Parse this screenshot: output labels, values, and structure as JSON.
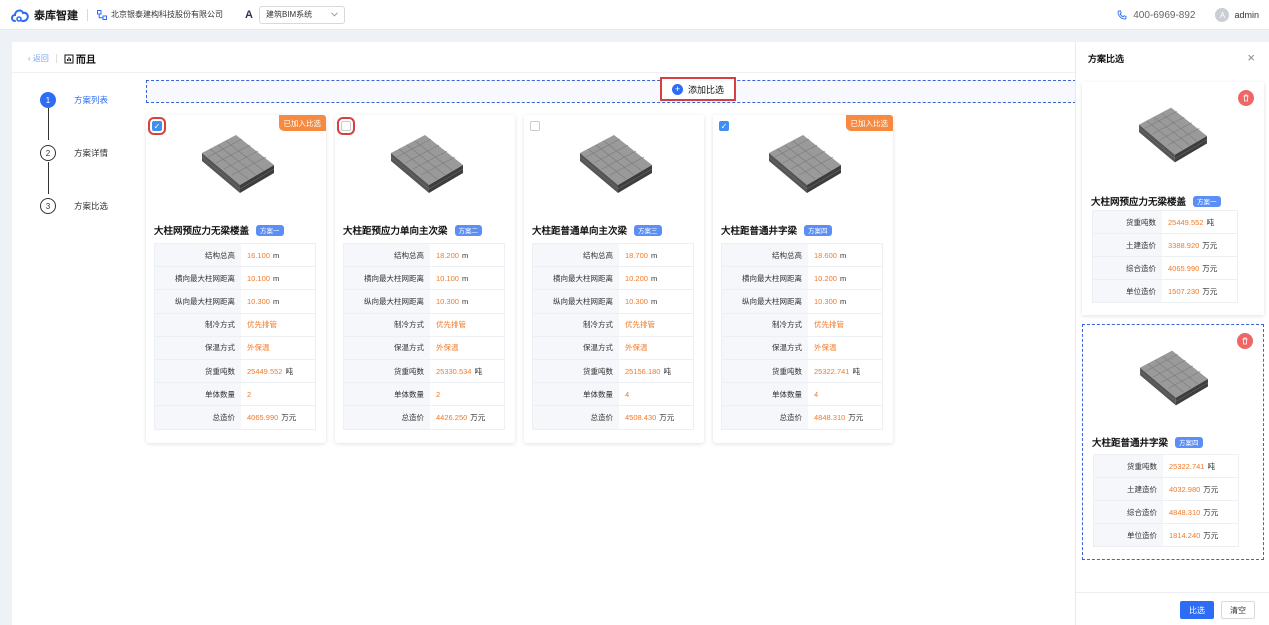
{
  "header": {
    "brand": "泰库智建",
    "company": "北京银泰建构科技股份有限公司",
    "system_value": "建筑BIM系统",
    "phone": "400-6969-892",
    "avatar_letter": "A",
    "username": "admin"
  },
  "breadcrumb": {
    "back": "返回",
    "title": "而且"
  },
  "steps": [
    {
      "num": "1",
      "label": "方案列表",
      "active": true
    },
    {
      "num": "2",
      "label": "方案详情",
      "active": false
    },
    {
      "num": "3",
      "label": "方案比选",
      "active": false
    }
  ],
  "add_button": "添加比选",
  "added_tag": "已加入比选",
  "cards": [
    {
      "title": "大柱网预应力无梁楼盖",
      "badge": "方案一",
      "checked": true,
      "added": true,
      "rows": [
        [
          "结构总高",
          "16.100",
          "m"
        ],
        [
          "横向最大柱网距离",
          "10.100",
          "m"
        ],
        [
          "纵向最大柱网距离",
          "10.300",
          "m"
        ],
        [
          "制冷方式",
          "优先排管",
          ""
        ],
        [
          "保温方式",
          "外保温",
          ""
        ],
        [
          "货重吨数",
          "25449.552",
          "吨"
        ],
        [
          "单体数量",
          "2",
          ""
        ],
        [
          "总造价",
          "4065.990",
          "万元"
        ]
      ]
    },
    {
      "title": "大柱距预应力单向主次梁",
      "badge": "方案二",
      "checked": false,
      "added": false,
      "rows": [
        [
          "结构总高",
          "18.200",
          "m"
        ],
        [
          "横向最大柱网距离",
          "10.100",
          "m"
        ],
        [
          "纵向最大柱网距离",
          "10.300",
          "m"
        ],
        [
          "制冷方式",
          "优先排管",
          ""
        ],
        [
          "保温方式",
          "外保温",
          ""
        ],
        [
          "货重吨数",
          "25330.534",
          "吨"
        ],
        [
          "单体数量",
          "2",
          ""
        ],
        [
          "总造价",
          "4426.250",
          "万元"
        ]
      ]
    },
    {
      "title": "大柱距普通单向主次梁",
      "badge": "方案三",
      "checked": false,
      "added": false,
      "rows": [
        [
          "结构总高",
          "18.700",
          "m"
        ],
        [
          "横向最大柱网距离",
          "10.200",
          "m"
        ],
        [
          "纵向最大柱网距离",
          "10.300",
          "m"
        ],
        [
          "制冷方式",
          "优先排管",
          ""
        ],
        [
          "保温方式",
          "外保温",
          ""
        ],
        [
          "货重吨数",
          "25156.180",
          "吨"
        ],
        [
          "单体数量",
          "4",
          ""
        ],
        [
          "总造价",
          "4508.430",
          "万元"
        ]
      ]
    },
    {
      "title": "大柱距普通井字梁",
      "badge": "方案四",
      "checked": true,
      "added": true,
      "rows": [
        [
          "结构总高",
          "18.600",
          "m"
        ],
        [
          "横向最大柱网距离",
          "10.200",
          "m"
        ],
        [
          "纵向最大柱网距离",
          "10.300",
          "m"
        ],
        [
          "制冷方式",
          "优先排管",
          ""
        ],
        [
          "保温方式",
          "外保温",
          ""
        ],
        [
          "货重吨数",
          "25322.741",
          "吨"
        ],
        [
          "单体数量",
          "4",
          ""
        ],
        [
          "总造价",
          "4848.310",
          "万元"
        ]
      ]
    }
  ],
  "panel": {
    "title": "方案比选",
    "items": [
      {
        "title": "大柱网预应力无梁楼盖",
        "badge": "方案一",
        "rows": [
          [
            "货重吨数",
            "25449.552",
            "吨"
          ],
          [
            "土建造价",
            "3388.920",
            "万元"
          ],
          [
            "综合造价",
            "4065.990",
            "万元"
          ],
          [
            "单位造价",
            "1507.230",
            "万元"
          ]
        ]
      },
      {
        "title": "大柱距普通井字梁",
        "badge": "方案四",
        "rows": [
          [
            "货重吨数",
            "25322.741",
            "吨"
          ],
          [
            "土建造价",
            "4032.980",
            "万元"
          ],
          [
            "综合造价",
            "4848.310",
            "万元"
          ],
          [
            "单位造价",
            "1814.240",
            "万元"
          ]
        ]
      }
    ],
    "compare_button": "比选",
    "clear_button": "清空"
  }
}
